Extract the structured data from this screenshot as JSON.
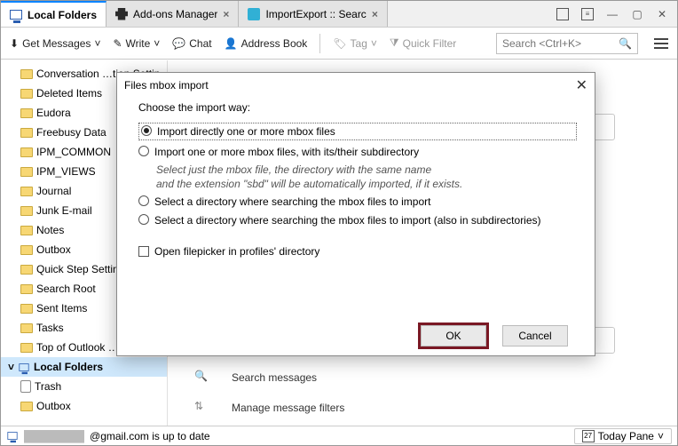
{
  "tabs": [
    {
      "label": "Local Folders"
    },
    {
      "label": "Add-ons Manager"
    },
    {
      "label": "ImportExport :: Searc"
    }
  ],
  "toolbar": {
    "get_messages": "Get Messages",
    "write": "Write",
    "chat": "Chat",
    "address_book": "Address Book",
    "tag": "Tag",
    "quick_filter": "Quick Filter",
    "search_placeholder": "Search <Ctrl+K>"
  },
  "folders": [
    "Conversation …tion Settin",
    "Deleted Items",
    "Eudora",
    "Freebusy Data",
    "IPM_COMMON",
    "IPM_VIEWS",
    "Journal",
    "Junk E-mail",
    "Notes",
    "Outbox",
    "Quick Step Settin",
    "Search Root",
    "Sent Items",
    "Tasks",
    "Top of Outlook …"
  ],
  "account": {
    "name": "Local Folders",
    "trash": "Trash",
    "outbox": "Outbox"
  },
  "actions": {
    "search": "Search messages",
    "filters": "Manage message filters"
  },
  "dialog": {
    "title": "Files mbox import",
    "prompt": "Choose the import way:",
    "opt1": "Import directly one or more mbox files",
    "opt2": "Import one or more mbox files, with its/their subdirectory",
    "hint1": "Select just the mbox file, the directory with the same name",
    "hint2": "and the extension \"sbd\" will be automatically imported, if it exists.",
    "opt3": "Select a directory where searching the mbox files to import",
    "opt4": "Select a directory where searching the mbox files to import (also in subdirectories)",
    "check": "Open filepicker in profiles' directory",
    "ok": "OK",
    "cancel": "Cancel"
  },
  "status": {
    "text": "@gmail.com is up to date",
    "today_pane": "Today Pane",
    "day": "27"
  }
}
